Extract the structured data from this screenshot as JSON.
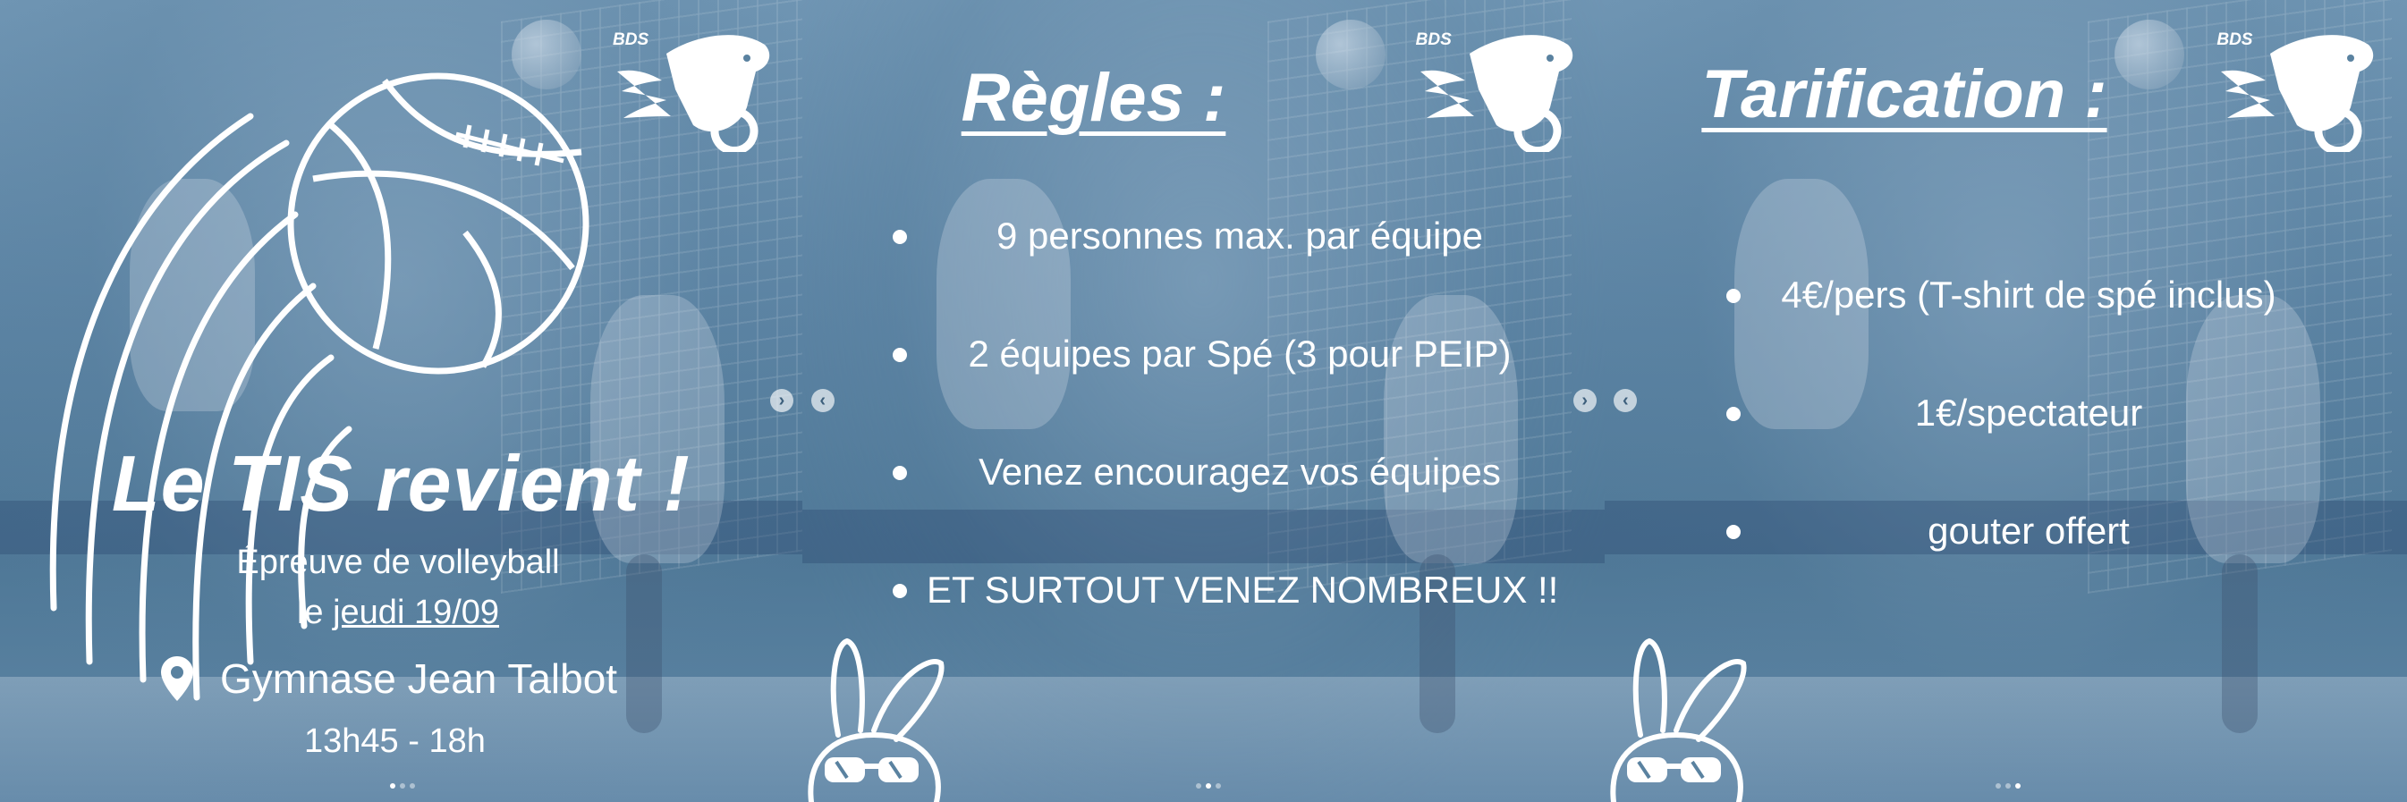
{
  "brand": {
    "logo_text": "BDS"
  },
  "slide1": {
    "title": "Le TIS revient !",
    "subtitle_line1": "Épreuve de volleyball",
    "subtitle_line2_prefix": "le ",
    "subtitle_line2_date": "jeudi 19/09",
    "location": "Gymnase Jean Talbot",
    "time": "13h45 - 18h"
  },
  "slide2": {
    "heading": "Règles :",
    "rules": [
      "9 personnes max. par équipe",
      "2 équipes par Spé (3 pour PEIP)",
      "Venez encouragez vos équipes",
      "ET SURTOUT VENEZ NOMBREUX !!"
    ]
  },
  "slide3": {
    "heading": "Tarification :",
    "prices": [
      "4€/pers (T-shirt de spé inclus)",
      "1€/spectateur",
      "gouter offert"
    ]
  },
  "carousel": {
    "next_symbol": "›",
    "prev_symbol": "‹",
    "slide_count": 3
  },
  "icons": [
    "volleyball-icon",
    "location-pin-icon",
    "bunny-logo-icon",
    "bunny-sunglasses-icon",
    "chevron-right-icon",
    "chevron-left-icon"
  ],
  "colors": {
    "overlay": "#5a82a0",
    "text": "#ffffff"
  }
}
